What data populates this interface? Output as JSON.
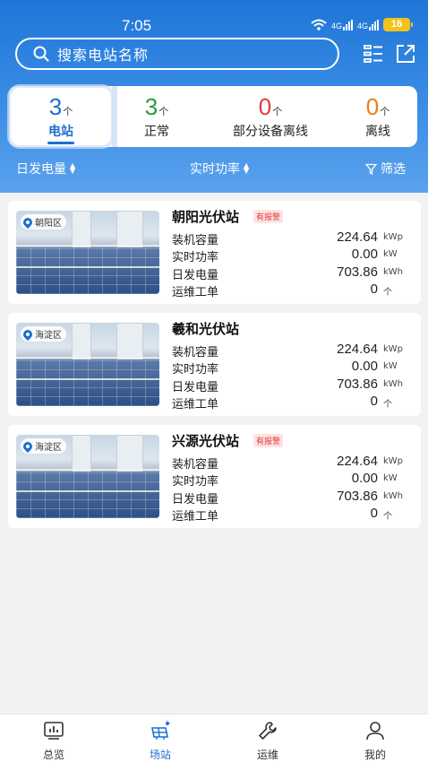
{
  "status_bar": {
    "time": "7:05",
    "net1": "4G",
    "net2": "4G",
    "battery": "16"
  },
  "search": {
    "placeholder": "搜索电站名称"
  },
  "summary": [
    {
      "count": "3",
      "unit": "个",
      "label": "电站",
      "color": "#1c6fd1",
      "active": true
    },
    {
      "count": "3",
      "unit": "个",
      "label": "正常",
      "color": "#2a9d3a"
    },
    {
      "count": "0",
      "unit": "个",
      "label": "部分设备离线",
      "color": "#e23b3b"
    },
    {
      "count": "0",
      "unit": "个",
      "label": "离线",
      "color": "#f07d1a"
    }
  ],
  "sort": {
    "daily_energy": "日发电量",
    "realtime_power": "实时功率",
    "filter": "筛选"
  },
  "stations": [
    {
      "name": "朝阳光伏站",
      "alarm": "有报警",
      "district": "朝阳区",
      "capacity_label": "装机容量",
      "capacity": "224.64",
      "capacity_unit": "kWp",
      "power_label": "实时功率",
      "power": "0.00",
      "power_unit": "kW",
      "energy_label": "日发电量",
      "energy": "703.86",
      "energy_unit": "kWh",
      "orders_label": "运维工单",
      "orders": "0",
      "orders_unit": "个"
    },
    {
      "name": "羲和光伏站",
      "alarm": "",
      "district": "海淀区",
      "capacity_label": "装机容量",
      "capacity": "224.64",
      "capacity_unit": "kWp",
      "power_label": "实时功率",
      "power": "0.00",
      "power_unit": "kW",
      "energy_label": "日发电量",
      "energy": "703.86",
      "energy_unit": "kWh",
      "orders_label": "运维工单",
      "orders": "0",
      "orders_unit": "个"
    },
    {
      "name": "兴源光伏站",
      "alarm": "有报警",
      "district": "海淀区",
      "capacity_label": "装机容量",
      "capacity": "224.64",
      "capacity_unit": "kWp",
      "power_label": "实时功率",
      "power": "0.00",
      "power_unit": "kW",
      "energy_label": "日发电量",
      "energy": "703.86",
      "energy_unit": "kWh",
      "orders_label": "运维工单",
      "orders": "0",
      "orders_unit": "个"
    }
  ],
  "nav": [
    {
      "label": "总览",
      "icon": "overview-chart-icon"
    },
    {
      "label": "场站",
      "icon": "station-solar-icon",
      "active": true
    },
    {
      "label": "运维",
      "icon": "wrench-icon"
    },
    {
      "label": "我的",
      "icon": "profile-icon"
    }
  ]
}
